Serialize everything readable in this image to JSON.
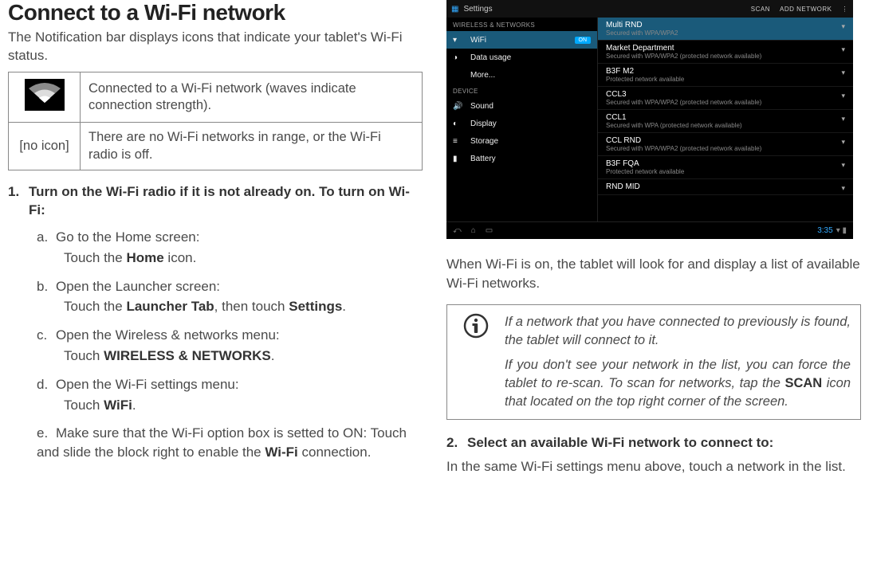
{
  "title": "Connect to a Wi-Fi network",
  "intro": "The Notification bar displays icons that indicate your tablet's Wi-Fi status.",
  "table": {
    "row1_desc": "Connected to a Wi-Fi network (waves indicate connection strength).",
    "row2_icon": "[no icon]",
    "row2_desc": "There are no Wi-Fi networks in range, or the Wi-Fi radio is off."
  },
  "step1": {
    "num": "1.",
    "head": "Turn on the Wi-Fi radio if it is not already on. To turn on Wi-Fi:",
    "a": {
      "lbl": "a.",
      "title": "Go to the Home screen:",
      "body_pre": "Touch the ",
      "body_b": "Home",
      "body_post": " icon."
    },
    "b": {
      "lbl": "b.",
      "title": "Open the Launcher screen:",
      "body_pre": "Touch the ",
      "body_b1": "Launcher Tab",
      "body_mid": ", then touch ",
      "body_b2": "Settings",
      "body_post": "."
    },
    "c": {
      "lbl": "c.",
      "title": "Open the Wireless & networks menu:",
      "body_pre": "Touch ",
      "body_b": "WIRELESS & NETWORKS",
      "body_post": "."
    },
    "d": {
      "lbl": "d.",
      "title": "Open the Wi-Fi settings menu:",
      "body_pre": "Touch ",
      "body_b": "WiFi",
      "body_post": "."
    },
    "e": {
      "lbl": "e.",
      "title_pre": "Make sure that the Wi-Fi option box is setted to ON:  Touch and slide the block right to enable the ",
      "title_b": "Wi-Fi",
      "title_post": " connection."
    }
  },
  "screenshot": {
    "settings_label": "Settings",
    "scan": "SCAN",
    "add_network": "ADD NETWORK",
    "cat1": "WIRELESS & NETWORKS",
    "wifi": "WiFi",
    "on": "ON",
    "data_usage": "Data usage",
    "more": "More...",
    "cat2": "DEVICE",
    "sound": "Sound",
    "display": "Display",
    "storage": "Storage",
    "battery": "Battery",
    "nets": [
      {
        "name": "Multi RND",
        "sub": "Secured with WPA/WPA2"
      },
      {
        "name": "Market Department",
        "sub": "Secured with WPA/WPA2 (protected network available)"
      },
      {
        "name": "B3F M2",
        "sub": "Protected network available"
      },
      {
        "name": "CCL3",
        "sub": "Secured with WPA/WPA2 (protected network available)"
      },
      {
        "name": "CCL1",
        "sub": "Secured with WPA (protected network available)"
      },
      {
        "name": "CCL RND",
        "sub": "Secured with WPA/WPA2 (protected network available)"
      },
      {
        "name": "B3F FQA",
        "sub": "Protected network available"
      },
      {
        "name": "RND MID",
        "sub": ""
      }
    ],
    "clock": "3:35"
  },
  "after_ss": "When Wi-Fi is on, the tablet will look for and display a list of available Wi-Fi networks.",
  "info": {
    "p1": "If a network that you have connected to previously is found, the tablet will connect to it.",
    "p2_pre": "If you don't see your network in the list, you can force the tablet to re-scan. To scan for networks, tap the ",
    "p2_b": "SCAN",
    "p2_post": " icon that located on the top right corner of the screen."
  },
  "step2": {
    "num": "2.",
    "head": "Select an available Wi-Fi network to connect to:",
    "body": "In the same Wi-Fi settings menu above, touch a network in the list."
  }
}
